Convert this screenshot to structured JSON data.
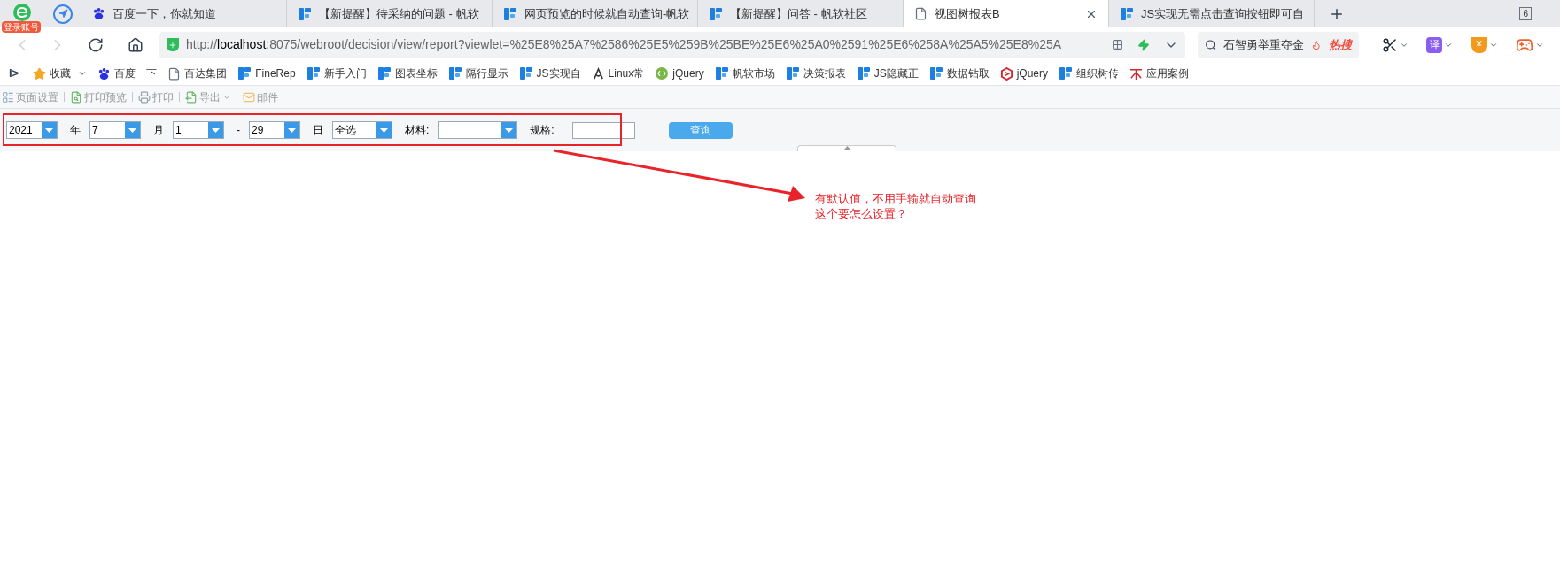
{
  "browser": {
    "account_badge": "登录账号",
    "tabs": [
      {
        "title": "百度一下，你就知道",
        "kind": "baidu",
        "selected": false
      },
      {
        "title": "【新提醒】待采纳的问题 - 帆软",
        "kind": "fanruan",
        "selected": false
      },
      {
        "title": "网页预览的时候就自动查询-帆软",
        "kind": "fanruan",
        "selected": false
      },
      {
        "title": "【新提醒】问答 - 帆软社区",
        "kind": "fanruan",
        "selected": false
      },
      {
        "title": "视图树报表B",
        "kind": "page",
        "selected": true
      },
      {
        "title": "JS实现无需点击查询按钮即可自",
        "kind": "fanruan",
        "selected": false
      }
    ],
    "tab_count": "6",
    "url": "http://**localhost**:8075/webroot/decision/view/report?viewlet=%25E8%25A7%2586%25E5%259B%25BE%25E6%25A0%2591%25E6%258A%25A5%25E8%25A",
    "search": {
      "value": "石智勇举重夺金",
      "hot_label": "热搜"
    },
    "extensions": [
      {
        "kind": "scissors"
      },
      {
        "kind": "translate",
        "label": "译"
      },
      {
        "kind": "coin",
        "label": "¥"
      },
      {
        "kind": "game"
      }
    ],
    "sidebar_toggle": "I>",
    "bookmarks": [
      {
        "label": "收藏",
        "kind": "star"
      },
      {
        "label": "百度一下",
        "kind": "baidu"
      },
      {
        "label": "百达集团",
        "kind": "page"
      },
      {
        "label": "FineRep",
        "kind": "fanruan"
      },
      {
        "label": "新手入门",
        "kind": "fanruan"
      },
      {
        "label": "图表坐标",
        "kind": "fanruan"
      },
      {
        "label": "隔行显示",
        "kind": "fanruan"
      },
      {
        "label": "JS实现自",
        "kind": "fanruan"
      },
      {
        "label": "Linux常",
        "kind": "linux"
      },
      {
        "label": "jQuery",
        "kind": "jquery"
      },
      {
        "label": "帆软市场",
        "kind": "fanruan"
      },
      {
        "label": "决策报表",
        "kind": "fanruan"
      },
      {
        "label": "JS隐藏正",
        "kind": "fanruan"
      },
      {
        "label": "数据钻取",
        "kind": "fanruan"
      },
      {
        "label": "jQuery",
        "kind": "jqred"
      },
      {
        "label": "组织树传",
        "kind": "fanruan"
      },
      {
        "label": "应用案例",
        "kind": "app"
      }
    ]
  },
  "toolbar": [
    {
      "label": "页面设置",
      "kind": "layout",
      "menu": false
    },
    {
      "label": "打印预览",
      "kind": "preview",
      "menu": false
    },
    {
      "label": "打印",
      "kind": "print",
      "menu": false
    },
    {
      "label": "导出",
      "kind": "export",
      "menu": true
    },
    {
      "label": "邮件",
      "kind": "mail",
      "menu": false
    }
  ],
  "form": [
    {
      "kind": "combo",
      "value": "2021"
    },
    {
      "kind": "label",
      "text": "年"
    },
    {
      "kind": "combo",
      "value": "7"
    },
    {
      "kind": "label",
      "text": "月"
    },
    {
      "kind": "combo",
      "value": "1"
    },
    {
      "kind": "label",
      "text": "-"
    },
    {
      "kind": "combo",
      "value": "29"
    },
    {
      "kind": "label",
      "text": "日"
    },
    {
      "kind": "combo",
      "value": "全选"
    },
    {
      "kind": "label",
      "text": "材料:"
    },
    {
      "kind": "combo"
    },
    {
      "kind": "label",
      "text": "规格:"
    },
    {
      "kind": "input"
    }
  ],
  "query_button": "查询",
  "annotation": {
    "lines": [
      "有默认值，不用手输就自动查询",
      "这个要怎么设置？"
    ]
  }
}
